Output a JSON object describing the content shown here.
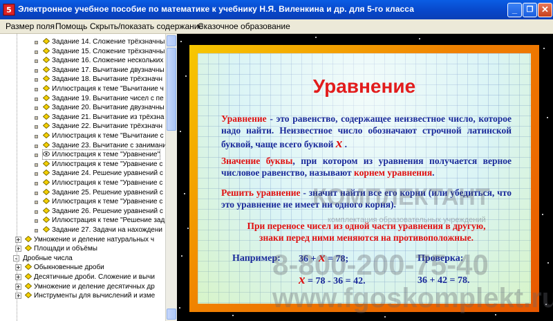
{
  "window": {
    "title": "Электронное учебное пособие по математике к учебнику Н.Я. Виленкина и др. для 5-го класса"
  },
  "menu": {
    "items": [
      "Размер поля",
      "Помощь",
      "Скрыть/показать содержание",
      "Сказочное образование"
    ]
  },
  "tree": {
    "items": [
      {
        "label": "Задание 14. Сложение трёхзначны",
        "type": "task"
      },
      {
        "label": "Задание 15. Сложение трёхзначны",
        "type": "task"
      },
      {
        "label": "Задание 16. Сложение нескольких",
        "type": "task"
      },
      {
        "label": "Задание 17. Вычитание двузначны",
        "type": "task"
      },
      {
        "label": "Задание 18. Вычитание трёхзначн",
        "type": "task"
      },
      {
        "label": "Иллюстрация к теме \"Вычитание ч",
        "type": "illustration"
      },
      {
        "label": "Задание 19. Вычитание чисел с пе",
        "type": "task"
      },
      {
        "label": "Задание 20. Вычитание двузначны",
        "type": "task"
      },
      {
        "label": "Задание 21. Вычитание из трёхзна",
        "type": "task"
      },
      {
        "label": "Задание 22. Вычитание трёхзначн",
        "type": "task"
      },
      {
        "label": "Иллюстрация к теме \"Вычитание с",
        "type": "illustration"
      },
      {
        "label": "Задание 23. Вычитание с занимани",
        "type": "task"
      },
      {
        "label": "Иллюстрация к теме \"Уравнение\"",
        "type": "illustration",
        "selected": true
      },
      {
        "label": "Иллюстрация к теме \"Уравнение с",
        "type": "illustration"
      },
      {
        "label": "Задание 24. Решение уравнений с",
        "type": "task"
      },
      {
        "label": "Иллюстрация к теме \"Уравнение с",
        "type": "illustration"
      },
      {
        "label": "Задание 25. Решение уравнений с",
        "type": "task"
      },
      {
        "label": "Иллюстрация к теме \"Уравнение с",
        "type": "illustration"
      },
      {
        "label": "Задание 26. Решение уравнений с",
        "type": "task"
      },
      {
        "label": "Иллюстрация к теме \"Решение зад",
        "type": "illustration"
      },
      {
        "label": "Задание 27. Задачи на нахождени",
        "type": "task"
      },
      {
        "label": "Умножение и деление натуральных ч",
        "type": "section"
      },
      {
        "label": "Площади и объёмы",
        "type": "section"
      },
      {
        "label": "Дробные числа",
        "type": "chapter"
      },
      {
        "label": "Обыкновенные дроби",
        "type": "section"
      },
      {
        "label": "Десятичные дроби. Сложение и вычи",
        "type": "section"
      },
      {
        "label": "Умножение и деление десятичных др",
        "type": "section"
      },
      {
        "label": "Инструменты для вычислений и изме",
        "type": "section"
      }
    ]
  },
  "slide": {
    "heading": "Уравнение",
    "p1_term": "Уравнение",
    "p1_text": " - это равенство, содержащее неизвестное число, которое надо найти. Неизвестное число обозначают строчной латинской буквой, чаще всего буквой ",
    "p1_var": "x",
    "p1_end": " .",
    "p2_term": "Значение буквы",
    "p2_text": ", при котором из уравнения получается верное числовое равенство, называют ",
    "p2_term2": "корнем уравнения",
    "p2_end": ".",
    "p3_term": "Решить уравнение",
    "p3_text": " - значит найти все его корни (или убедиться, что это уравнение не имеет ни одного корня).",
    "p4_line1": "При переносе чисел из одной части уравнения в другую,",
    "p4_line2": "знаки перед ними меняются на противоположные.",
    "example_label": "Например:",
    "check_label": "Проверка:",
    "eq1_a": "36 + ",
    "eq1_x": "x",
    "eq1_b": " = 78;",
    "eq2_x": "x",
    "eq2_b": " = 78 - 36 = 42.",
    "check_eq": "36 + 42 = 78."
  },
  "watermark": {
    "brand": "КОМПЛЕКТАНТ",
    "sub": "комплектация образовательных учреждений",
    "phone": "8-800-200-75-40",
    "site": "www.fgoskomplekt.ru"
  }
}
